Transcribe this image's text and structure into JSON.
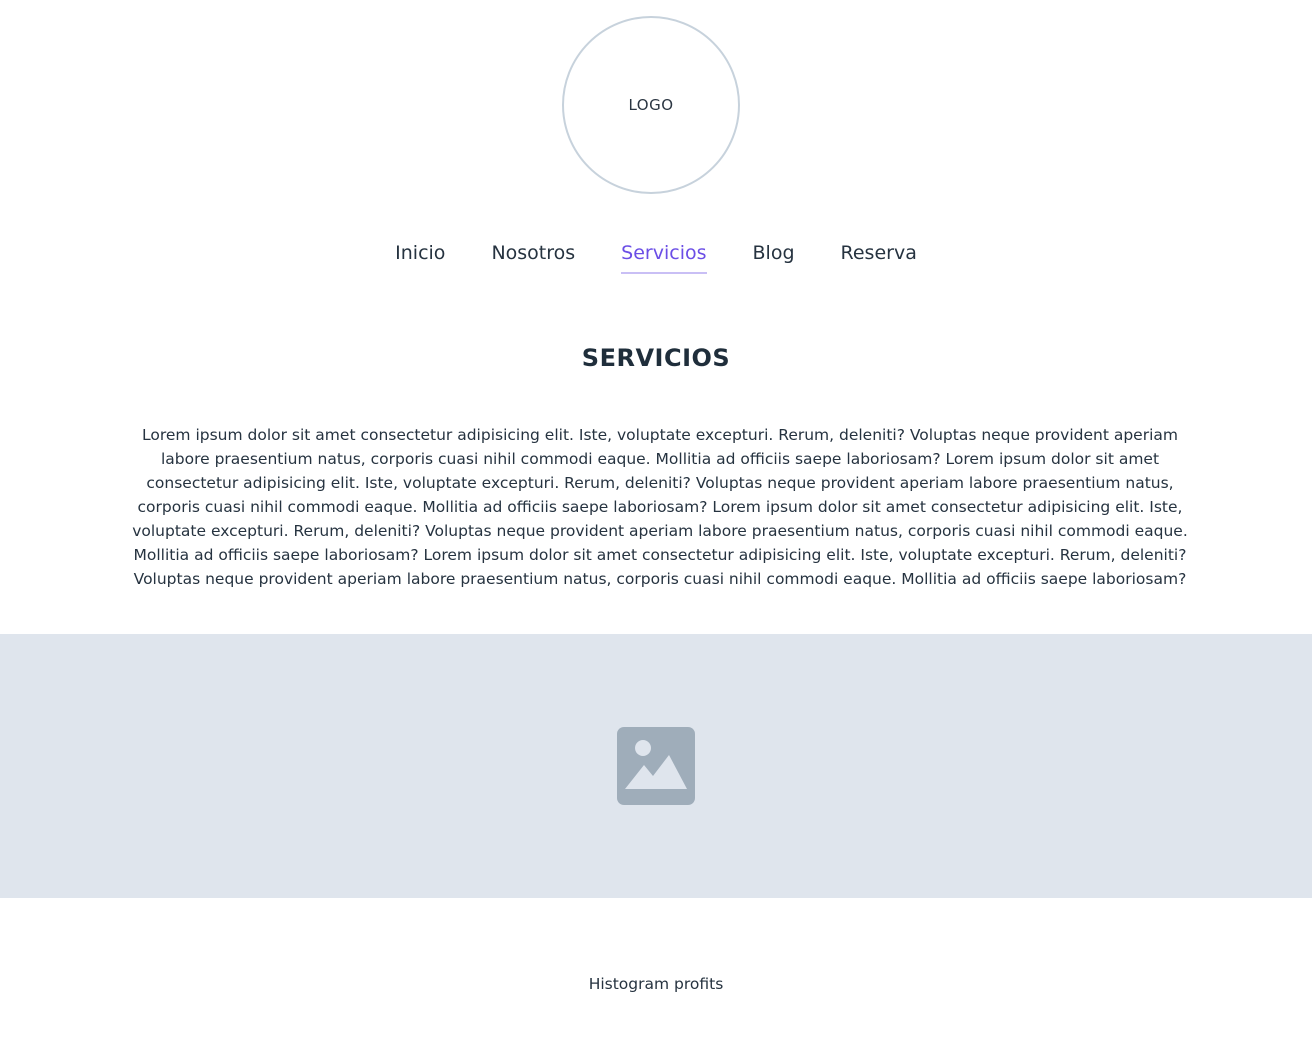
{
  "header": {
    "logo_text": "LOGO"
  },
  "nav": {
    "items": [
      {
        "label": "Inicio",
        "active": false
      },
      {
        "label": "Nosotros",
        "active": false
      },
      {
        "label": "Servicios",
        "active": true
      },
      {
        "label": "Blog",
        "active": false
      },
      {
        "label": "Reserva",
        "active": false
      }
    ],
    "active_color": "#6b4ee6"
  },
  "main": {
    "title": "SERVICIOS",
    "body": "Lorem ipsum dolor sit amet consectetur adipisicing elit. Iste, voluptate excepturi. Rerum, deleniti? Voluptas neque provident aperiam labore praesentium natus, corporis cuasi nihil commodi eaque. Mollitia ad officiis saepe laboriosam? Lorem ipsum dolor sit amet consectetur adipisicing elit. Iste, voluptate excepturi. Rerum, deleniti? Voluptas neque provident aperiam labore praesentium natus, corporis cuasi nihil commodi eaque. Mollitia ad officiis saepe laboriosam? Lorem ipsum dolor sit amet consectetur adipisicing elit. Iste, voluptate excepturi. Rerum, deleniti? Voluptas neque provident aperiam labore praesentium natus, corporis cuasi nihil commodi eaque. Mollitia ad officiis saepe laboriosam? Lorem ipsum dolor sit amet consectetur adipisicing elit. Iste, voluptate excepturi. Rerum, deleniti? Voluptas neque provident aperiam labore praesentium natus, corporis cuasi nihil commodi eaque. Mollitia ad officiis saepe laboriosam?",
    "image_placeholder_icon": "image-icon",
    "image_band_color": "#dfe5ed",
    "chart_caption": "Histogram profits"
  }
}
